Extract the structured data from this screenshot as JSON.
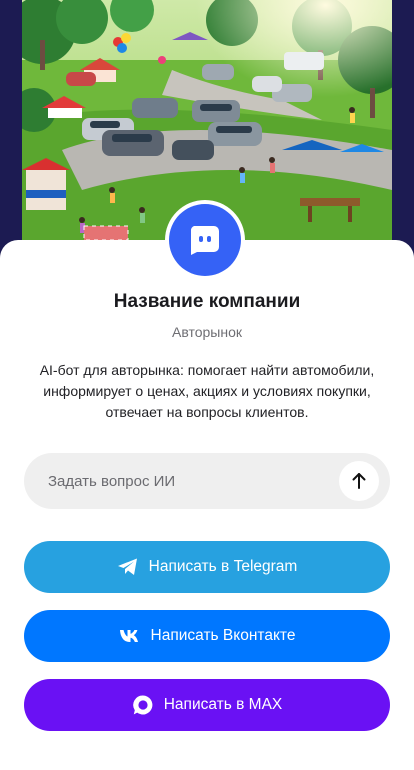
{
  "hero": {
    "image_alt": "",
    "background_color": "#1c1b52"
  },
  "avatar": {
    "icon": "chat-bot-icon",
    "color": "#3562f6"
  },
  "company": {
    "name": "Название компании",
    "category": "Авторынок",
    "description": "AI-бот для авторынка: помогает найти автомобили, информирует о ценах, акциях и условиях покупки, отвечает на вопросы клиентов."
  },
  "ask": {
    "placeholder": "Задать вопрос ИИ",
    "value": "",
    "send_icon": "arrow-up-icon"
  },
  "actions": [
    {
      "label": "Написать в Telegram",
      "icon": "telegram-icon",
      "color": "#27a1e0"
    },
    {
      "label": "Написать Вконтакте",
      "icon": "vk-icon",
      "color": "#0077ff"
    },
    {
      "label": "Написать в MAX",
      "icon": "max-icon",
      "color": "#6a11f4"
    }
  ]
}
